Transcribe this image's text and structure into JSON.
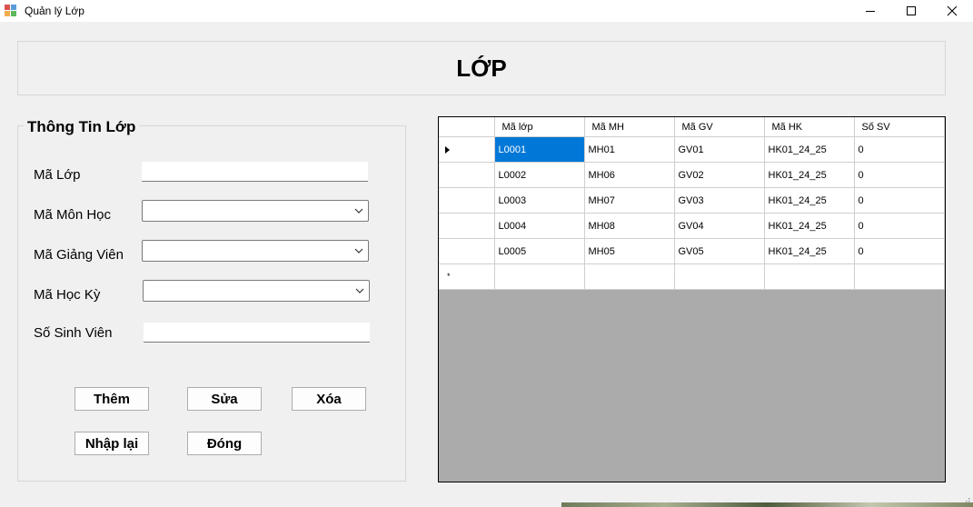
{
  "window": {
    "title": "Quản lý Lớp",
    "controls": [
      "minimize",
      "maximize",
      "close"
    ]
  },
  "header": {
    "title": "LỚP"
  },
  "form": {
    "group_title": "Thông Tin Lớp",
    "fields": {
      "ma_lop": {
        "label": "Mã Lớp",
        "value": ""
      },
      "ma_mon_hoc": {
        "label": "Mã Môn Học",
        "value": ""
      },
      "ma_giang_vien": {
        "label": "Mã Giảng Viên",
        "value": ""
      },
      "ma_hoc_ky": {
        "label": "Mã Học Kỳ",
        "value": ""
      },
      "so_sinh_vien": {
        "label": "Số Sinh Viên",
        "value": ""
      }
    },
    "buttons": {
      "them": "Thêm",
      "sua": "Sửa",
      "xoa": "Xóa",
      "nhap_lai": "Nhập lại",
      "dong": "Đóng"
    }
  },
  "grid": {
    "columns": [
      "Mã lớp",
      "Mã MH",
      "Mã GV",
      "Mã HK",
      "Số SV"
    ],
    "rows": [
      [
        "L0001",
        "MH01",
        "GV01",
        "HK01_24_25",
        "0"
      ],
      [
        "L0002",
        "MH06",
        "GV02",
        "HK01_24_25",
        "0"
      ],
      [
        "L0003",
        "MH07",
        "GV03",
        "HK01_24_25",
        "0"
      ],
      [
        "L0004",
        "MH08",
        "GV04",
        "HK01_24_25",
        "0"
      ],
      [
        "L0005",
        "MH05",
        "GV05",
        "HK01_24_25",
        "0"
      ]
    ],
    "selected_row": 0,
    "new_row_marker": "*",
    "colors": {
      "selection": "#0078d7",
      "empty_area": "#ababab"
    }
  }
}
